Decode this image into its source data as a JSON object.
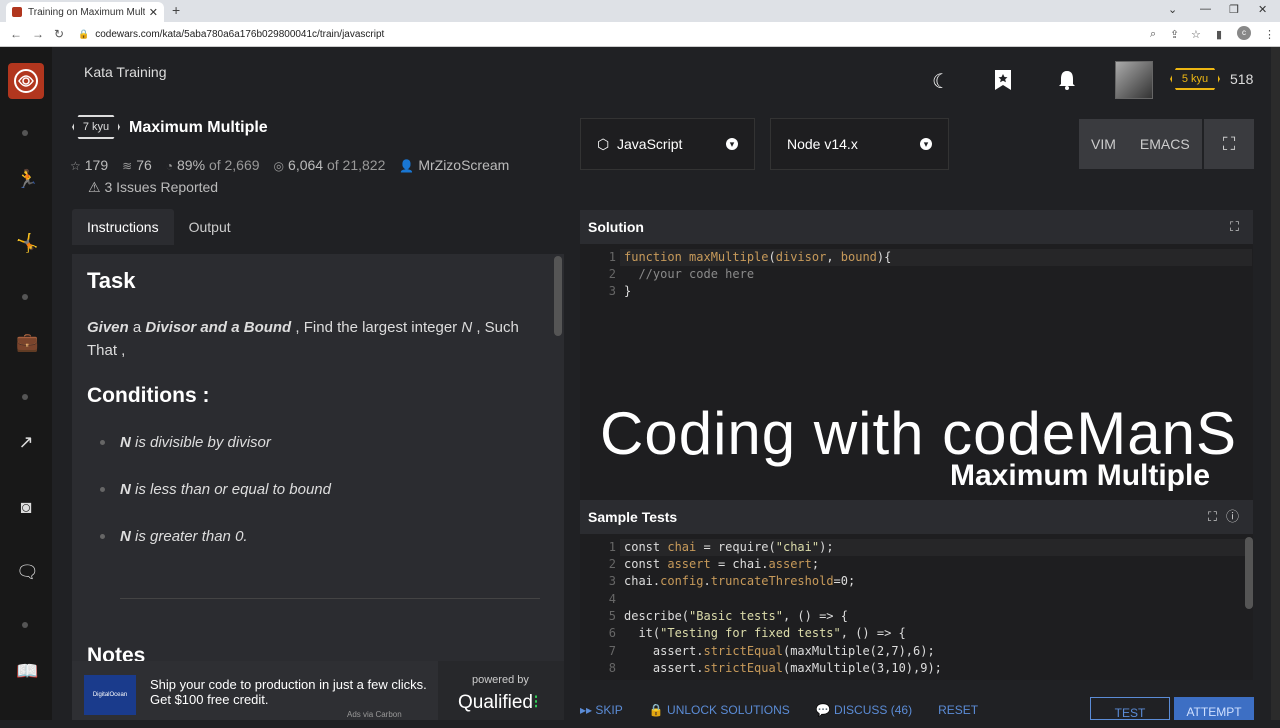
{
  "browser": {
    "tab_title": "Training on Maximum Multiple |",
    "url": "codewars.com/kata/5aba780a6a176b029800041c/train/javascript"
  },
  "header": {
    "section": "Kata Training",
    "rank": "5 kyu",
    "honor": "518"
  },
  "kata": {
    "rank": "7 kyu",
    "title": "Maximum Multiple",
    "stars": "179",
    "collections": "76",
    "satisfaction": "89%",
    "satisfaction_of": "of 2,669",
    "completed": "6,064",
    "completed_of": "of 21,822",
    "author": "MrZizoScream",
    "issues": "3 Issues Reported"
  },
  "tabs": [
    "Instructions",
    "Output"
  ],
  "instructions": {
    "task_heading": "Task",
    "p_given": "Given",
    "p_a": " a ",
    "p_divisor": "Divisor and a Bound",
    "p_find": " , Find the largest integer ",
    "p_n": "N",
    "p_rest": " , Such That ,",
    "conditions_heading": "Conditions :",
    "conditions": [
      {
        "n": "N",
        "text": " is divisible by divisor"
      },
      {
        "n": "N",
        "text": " is less than or equal to bound"
      },
      {
        "n": "N",
        "text": " is greater than 0."
      }
    ],
    "notes_heading": "Notes"
  },
  "ad": {
    "brand": "DigitalOcean",
    "text": "Ship your code to production in just a few clicks. Get $100 free credit.",
    "via": "Ads via Carbon",
    "powered": "powered by",
    "qualified": "Qualified"
  },
  "editor": {
    "language": "JavaScript",
    "version": "Node v14.x",
    "modes": [
      "VIM",
      "EMACS"
    ],
    "solution_title": "Solution",
    "solution_lines": [
      "1",
      "2",
      "3"
    ],
    "tests_title": "Sample Tests",
    "tests_lines": [
      "1",
      "2",
      "3",
      "4",
      "5",
      "6",
      "7",
      "8"
    ]
  },
  "watermark": {
    "line1": "Coding with codeManS",
    "line2": "Maximum Multiple"
  },
  "actions": {
    "skip": "SKIP",
    "unlock": "UNLOCK SOLUTIONS",
    "discuss": "DISCUSS (46)",
    "reset": "RESET",
    "test": "TEST",
    "attempt": "ATTEMPT"
  },
  "colors": {
    "brand_red": "#b1361e",
    "rank_yellow": "#ecb613",
    "action_blue": "#5b8cd6"
  }
}
